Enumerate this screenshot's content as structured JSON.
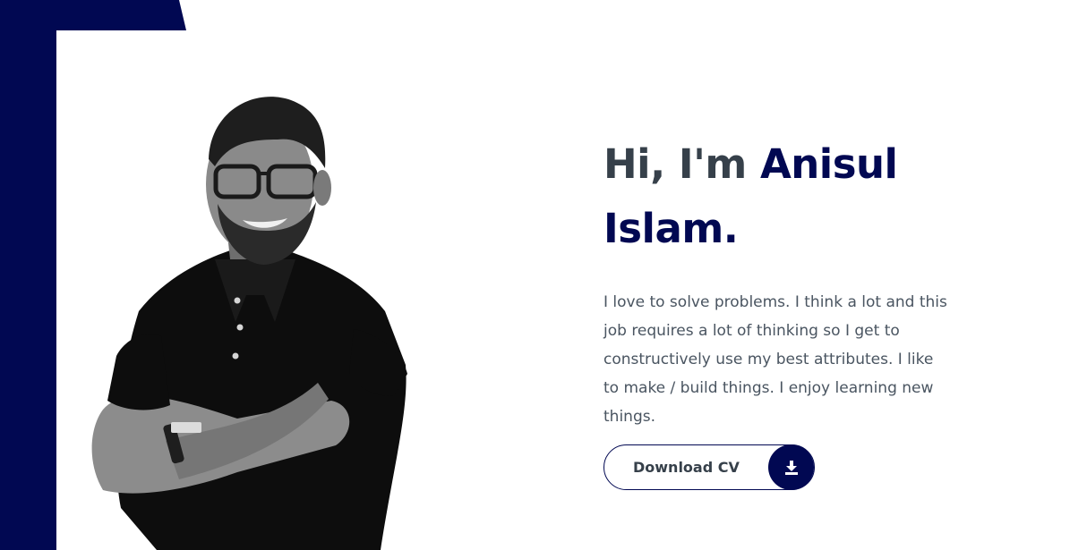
{
  "hero": {
    "greeting": "Hi, I'm ",
    "name_first": "Anisul",
    "name_last": "Islam.",
    "description": "I love to solve problems. I think a lot and this job requires a lot of thinking so I get to constructively use my best attributes. I like to make / build things. I enjoy learning new things."
  },
  "cv_button": {
    "label": "Download CV",
    "icon": "download-icon"
  },
  "colors": {
    "accent": "#010852",
    "heading": "#36404a",
    "body_text": "#4a5561",
    "background": "#ffffff"
  }
}
